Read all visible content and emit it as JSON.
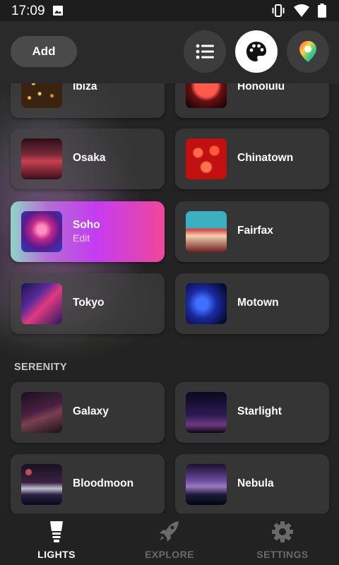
{
  "status_bar": {
    "time": "17:09",
    "icons": [
      "image-icon",
      "vibrate-icon",
      "wifi-icon",
      "battery-icon"
    ]
  },
  "header": {
    "add_label": "Add",
    "buttons": [
      "list-icon",
      "palette-icon",
      "map-pin-icon"
    ],
    "active_button": "palette-icon"
  },
  "scenes": {
    "row0": [
      {
        "name": "Ibiza"
      },
      {
        "name": "Honolulu"
      }
    ],
    "row1": [
      {
        "name": "Osaka"
      },
      {
        "name": "Chinatown"
      }
    ],
    "row2": [
      {
        "name": "Soho",
        "sub": "Edit",
        "active": true
      },
      {
        "name": "Fairfax"
      }
    ],
    "row3": [
      {
        "name": "Tokyo"
      },
      {
        "name": "Motown"
      }
    ]
  },
  "serenity": {
    "title": "SERENITY",
    "row0": [
      {
        "name": "Galaxy"
      },
      {
        "name": "Starlight"
      }
    ],
    "row1": [
      {
        "name": "Bloodmoon"
      },
      {
        "name": "Nebula"
      }
    ]
  },
  "bottom_nav": {
    "items": [
      {
        "label": "LIGHTS",
        "icon": "bulb-icon",
        "active": true
      },
      {
        "label": "EXPLORE",
        "icon": "rocket-icon",
        "active": false
      },
      {
        "label": "SETTINGS",
        "icon": "gear-icon",
        "active": false
      }
    ]
  },
  "colors": {
    "background": "#232323",
    "card": "#3a3a3a",
    "active_gradient": [
      "#8fd4c7",
      "#c43cf0",
      "#f0479a"
    ],
    "nav_inactive": "#6a6a6a"
  }
}
